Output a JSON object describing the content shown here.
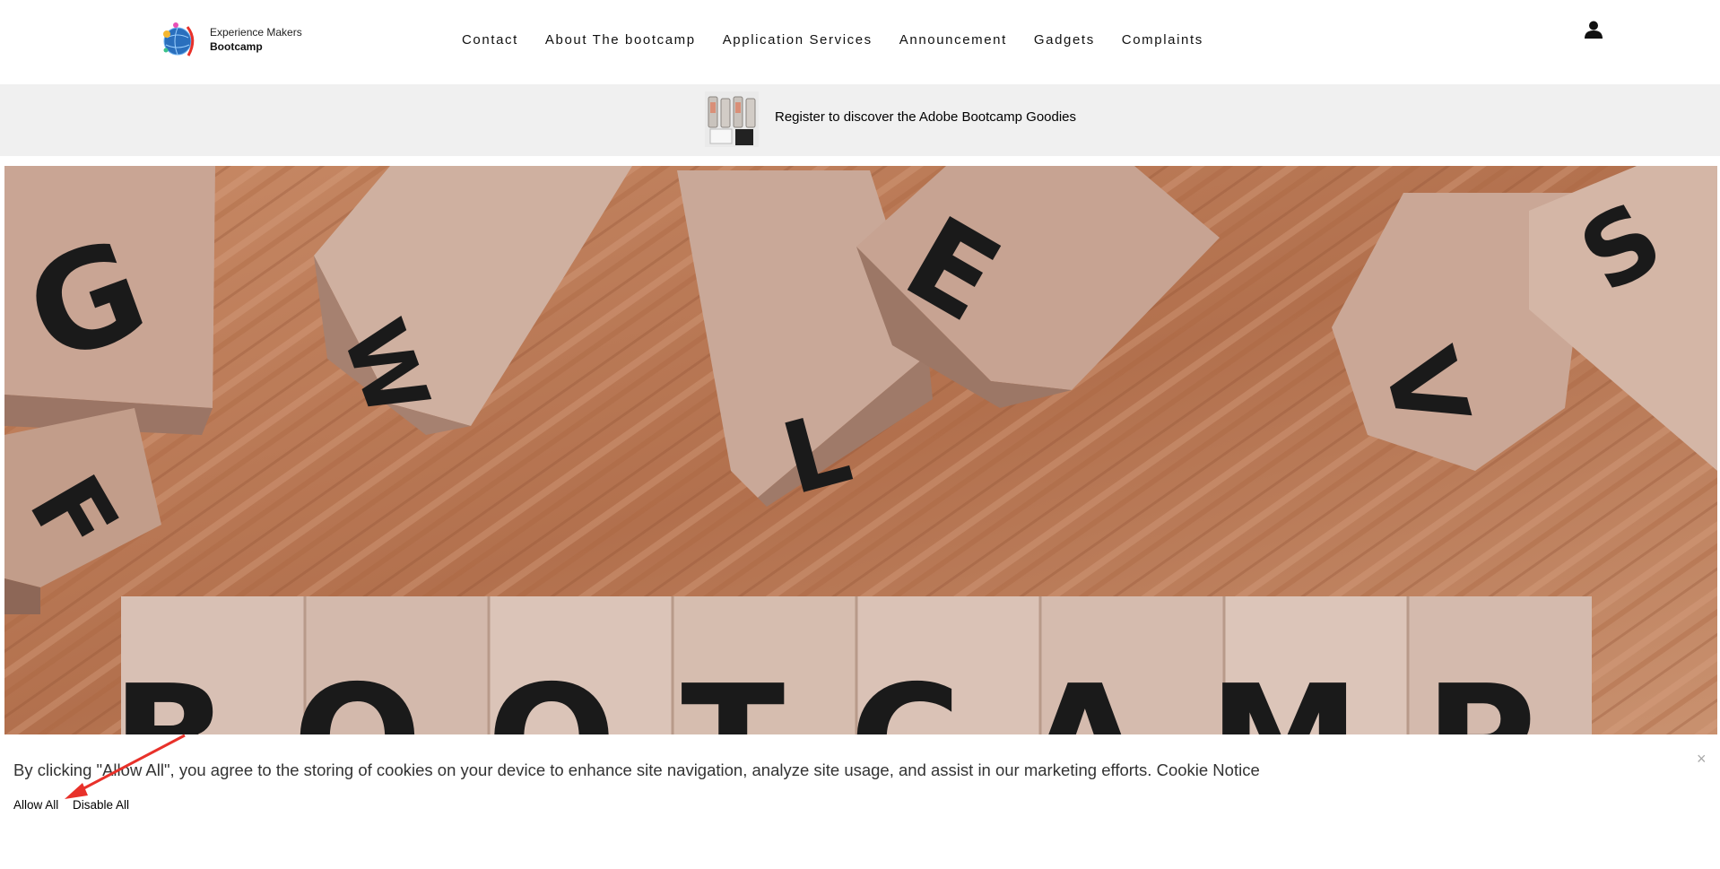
{
  "logo": {
    "line1": "Experience Makers",
    "line2": "Bootcamp"
  },
  "nav": {
    "items": [
      {
        "label": "Contact"
      },
      {
        "label": "About The bootcamp"
      },
      {
        "label": "Application Services"
      },
      {
        "label": "Announcement"
      },
      {
        "label": "Gadgets"
      },
      {
        "label": "Complaints"
      }
    ]
  },
  "promo": {
    "text": "Register to discover the Adobe Bootcamp Goodies"
  },
  "hero": {
    "letters_top": [
      "G",
      "W",
      "L",
      "E",
      "V",
      "S",
      "F"
    ],
    "word": "BOOTCAMP"
  },
  "cookie": {
    "text": "By clicking \"Allow All\", you agree to the storing of cookies on your device to enhance site navigation, analyze site usage, and assist in our marketing efforts.",
    "notice_link": "Cookie Notice",
    "allow_label": "Allow All",
    "disable_label": "Disable All",
    "close_glyph": "×"
  },
  "colors": {
    "annotation_arrow": "#e8312a",
    "wood": "#b87a57",
    "promo_bg": "#f0f0f0"
  },
  "icons": {
    "corner": "adobe-icon",
    "user": "user-icon"
  }
}
